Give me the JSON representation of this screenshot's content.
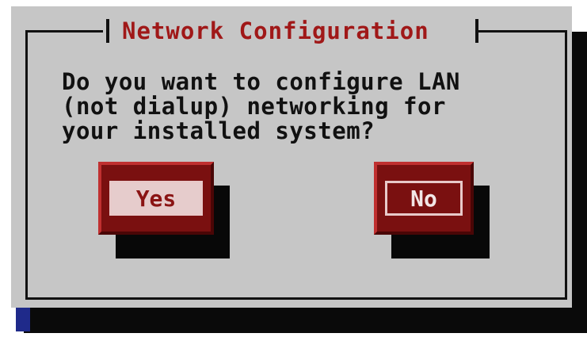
{
  "dialog": {
    "title": "Network Configuration",
    "message_lines": [
      "Do you want to configure LAN",
      "(not dialup) networking for",
      "your installed system?"
    ]
  },
  "buttons": {
    "yes_label": "Yes",
    "no_label": "No",
    "focused": "Yes"
  },
  "colors": {
    "dialog_background": "#c6c6c6",
    "title_text": "#a01818",
    "button_face": "#7a1010",
    "focused_button_fill": "#e6cccc",
    "shadow": "#0a0a0a",
    "cursor": "#1f2a8a"
  }
}
